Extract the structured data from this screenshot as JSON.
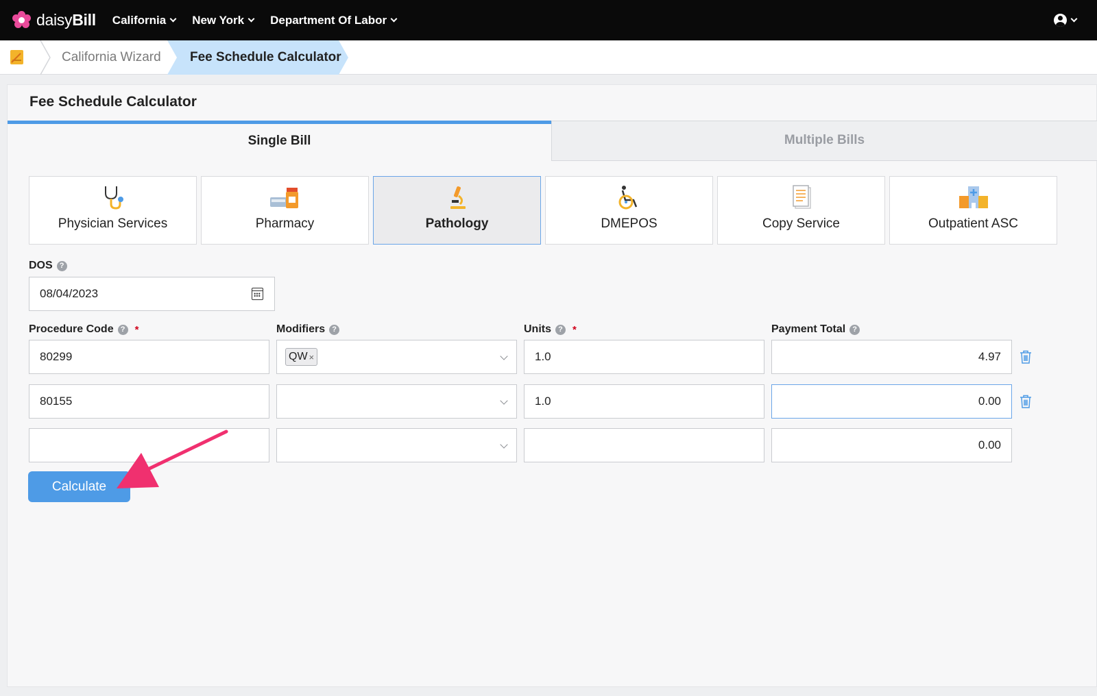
{
  "app": {
    "logo_light": "daisy",
    "logo_bold": "Bill"
  },
  "nav": {
    "items": [
      "California",
      "New York",
      "Department Of Labor"
    ]
  },
  "breadcrumb": {
    "items": [
      "California Wizard",
      "Fee Schedule Calculator"
    ]
  },
  "page": {
    "title": "Fee Schedule Calculator"
  },
  "tabs": {
    "single": "Single Bill",
    "multiple": "Multiple Bills",
    "active": "Single Bill"
  },
  "categories": {
    "items": [
      "Physician Services",
      "Pharmacy",
      "Pathology",
      "DMEPOS",
      "Copy Service",
      "Outpatient ASC"
    ],
    "selected": "Pathology"
  },
  "form": {
    "dos_label": "DOS",
    "dos_value": "08/04/2023",
    "headers": {
      "procedure": "Procedure Code",
      "modifiers": "Modifiers",
      "units": "Units",
      "payment": "Payment Total"
    },
    "required_mark": "*",
    "help_mark": "?",
    "rows": [
      {
        "procedure": "80299",
        "modifier": "QW",
        "units": "1.0",
        "payment": "4.97"
      },
      {
        "procedure": "80155",
        "modifier": "",
        "units": "1.0",
        "payment": "0.00"
      },
      {
        "procedure": "",
        "modifier": "",
        "units": "",
        "payment": "0.00"
      }
    ],
    "tag_remove": "×"
  },
  "actions": {
    "calculate": "Calculate"
  },
  "colors": {
    "accent": "#4e9be6",
    "nav_bg": "#0a0a0a",
    "arrow": "#f0306f",
    "brand": "#e94a9a"
  }
}
